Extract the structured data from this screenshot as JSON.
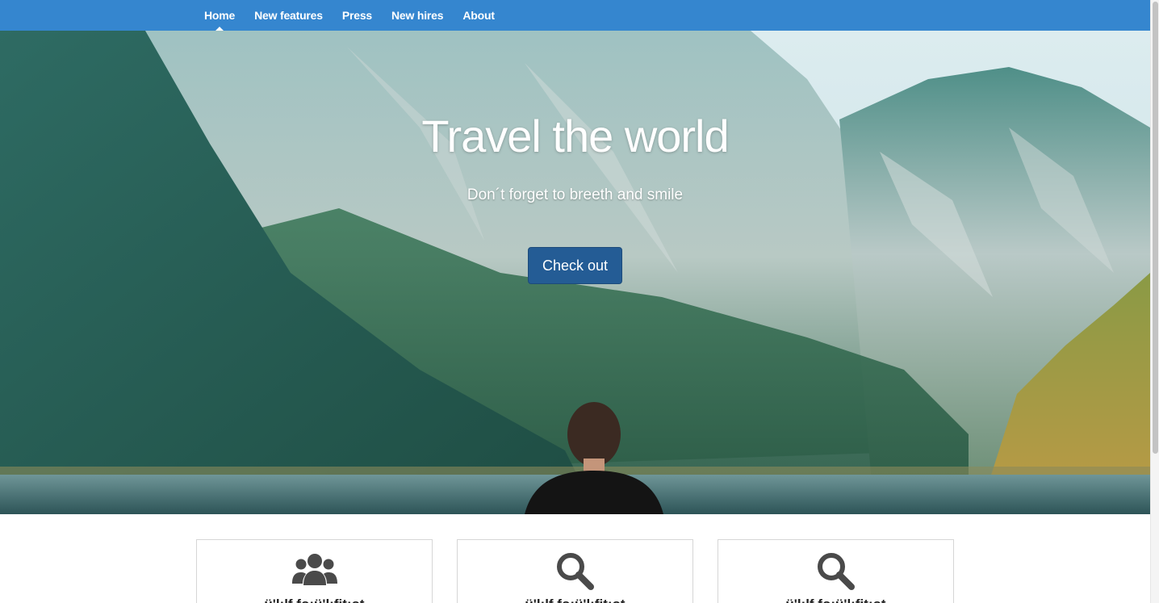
{
  "navbar": {
    "items": [
      {
        "label": "Home",
        "active": true
      },
      {
        "label": "New features"
      },
      {
        "label": "Press"
      },
      {
        "label": "New hires"
      },
      {
        "label": "About"
      }
    ],
    "background": "#3586cf"
  },
  "hero": {
    "title": "Travel the world",
    "subtitle": "Don´t forget to breeth and smile",
    "button_label": "Check out",
    "button_color": "#245c95"
  },
  "features": [
    {
      "icon": "users-icon",
      "title": "ü'l;lf fo;ü'l;fit;ot"
    },
    {
      "icon": "search-icon",
      "title": "ü'l;lf fo;ü'l;fit;ot"
    },
    {
      "icon": "search-icon",
      "title": "ü'l;lf fo;ü'l;fit;ot"
    }
  ]
}
